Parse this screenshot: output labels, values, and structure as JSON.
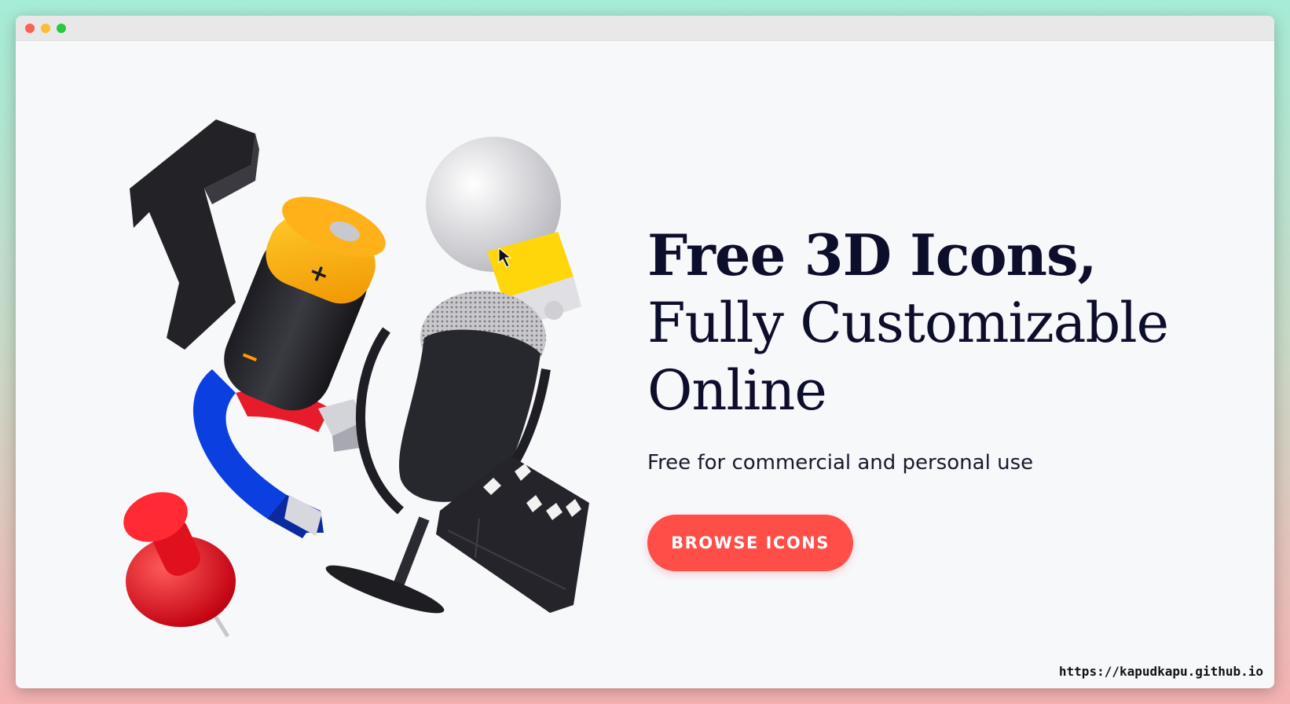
{
  "hero": {
    "headline_line1": "Free 3D Icons,",
    "headline_line2": "Fully Customizable",
    "headline_line3": "Online",
    "subtitle": "Free for commercial and personal use",
    "cta_label": "BROWSE ICONS"
  },
  "footer": {
    "url": "https://kapudkapu.github.io"
  },
  "colors": {
    "accent": "#ff4d47",
    "headline": "#0d0e2b",
    "background": "#f7f8fa"
  },
  "illustration": {
    "icons": [
      "letter-t-icon",
      "battery-icon",
      "magnet-icon",
      "push-pin-icon",
      "light-bulb-icon",
      "microphone-icon",
      "clapperboard-icon"
    ]
  }
}
